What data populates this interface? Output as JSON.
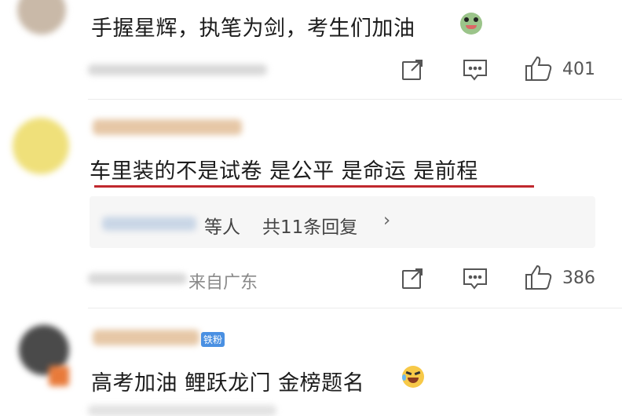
{
  "comments": [
    {
      "text": "手握星辉，执笔为剑，考生们加油",
      "emoji": "frog-emoji",
      "likes": "401"
    },
    {
      "text": "车里装的不是试卷 是公平 是命运 是前程",
      "replies": {
        "suffix": "等人",
        "count": "共11条回复",
        "chevron": "›"
      },
      "origin": "来自广东",
      "likes": "386",
      "underline_color": "#c0282e"
    },
    {
      "badge": "铁粉",
      "text": "高考加油 鲤跃龙门 金榜题名",
      "emoji": "crying-laugh-emoji"
    }
  ],
  "icons": [
    "share-icon",
    "comment-icon",
    "like-icon",
    "chevron-right-icon"
  ],
  "colors": {
    "badge": "#4a90e2",
    "underline": "#c0282e",
    "reply_bg": "#f6f6f6"
  }
}
